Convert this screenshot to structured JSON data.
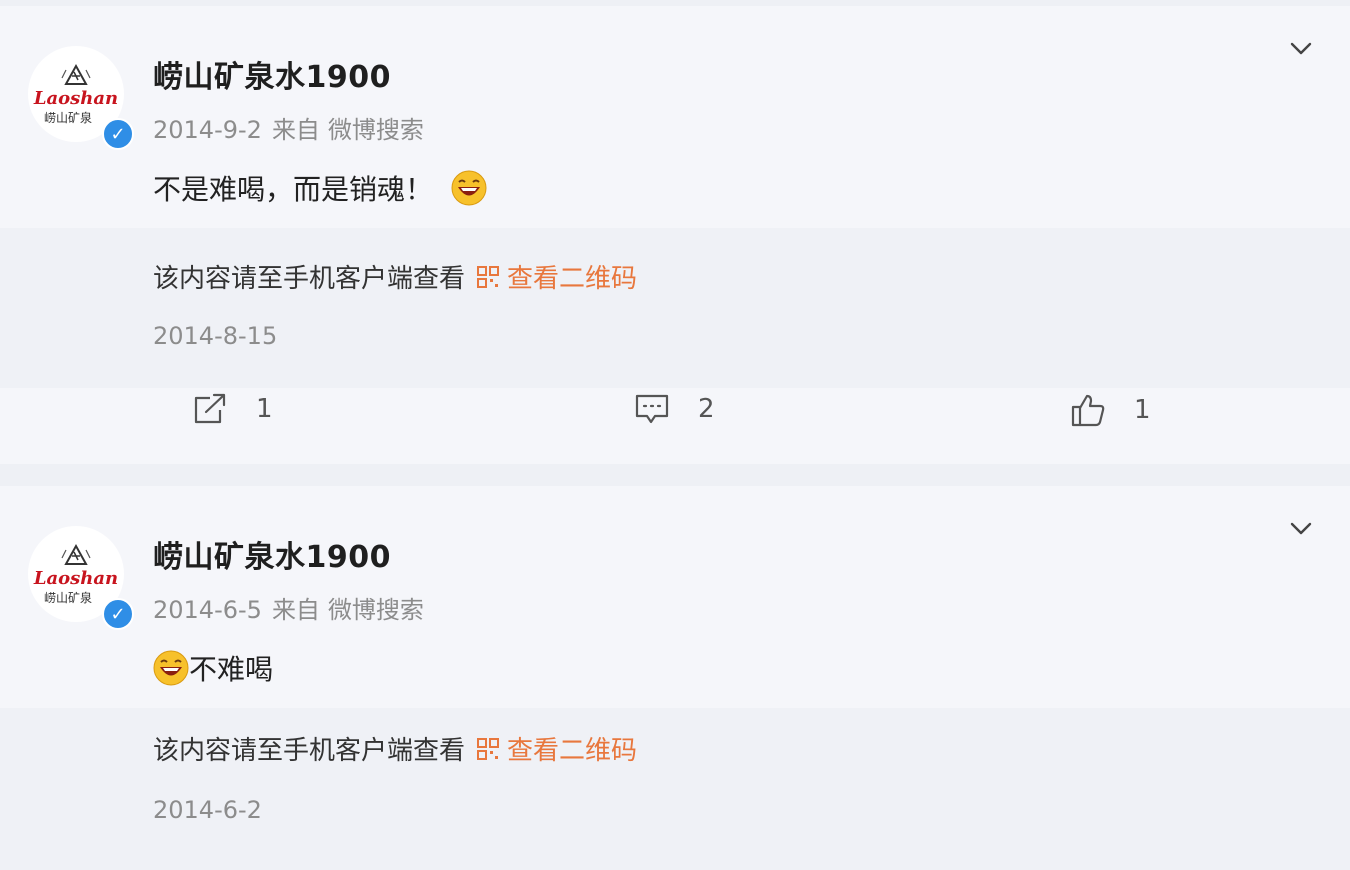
{
  "posts": [
    {
      "username": "崂山矿泉水1900",
      "date": "2014-9-2",
      "source_prefix": "来自",
      "source": "微博搜索",
      "text": "不是难喝，而是销魂！",
      "repost_message": "该内容请至手机客户端查看",
      "qr_link": "查看二维码",
      "repost_date": "2014-8-15",
      "actions": {
        "repost_count": "1",
        "comment_count": "2",
        "like_count": "1"
      }
    },
    {
      "username": "崂山矿泉水1900",
      "date": "2014-6-5",
      "source_prefix": "来自",
      "source": "微博搜索",
      "text": "不难喝",
      "repost_message": "该内容请至手机客户端查看",
      "qr_link": "查看二维码",
      "repost_date": "2014-6-2"
    }
  ],
  "avatar_logo_text": "Laoshan",
  "avatar_logo_cn": "崂山矿泉",
  "icons": {
    "verified": "verified-badge-icon",
    "chevron": "chevron-down-icon",
    "emoji": "laughing-emoji-icon",
    "qr": "qr-code-icon",
    "repost": "repost-icon",
    "comment": "comment-icon",
    "like": "thumbs-up-icon"
  },
  "colors": {
    "accent": "#e8773d",
    "verified": "#2f8ee6",
    "meta": "#8c8c8c"
  }
}
